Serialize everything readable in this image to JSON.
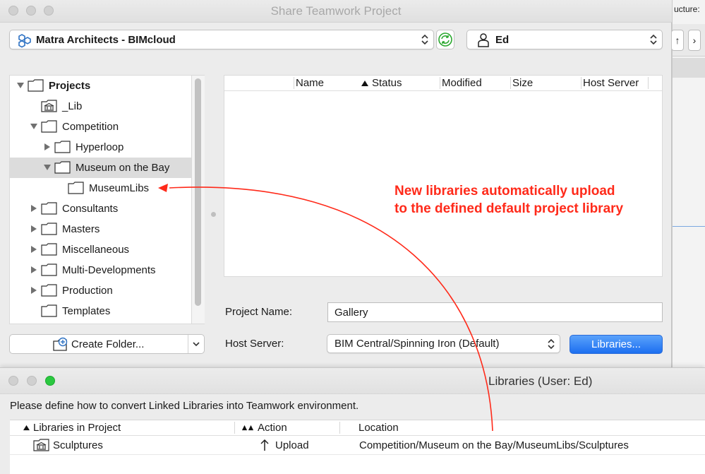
{
  "window": {
    "title": "Share Teamwork Project"
  },
  "background_app": {
    "label": "ucture:",
    "toolbar_glyph_1": "↑",
    "toolbar_glyph_2": "›"
  },
  "server": {
    "selected": "Matra Architects - BIMcloud"
  },
  "user": {
    "selected": "Ed"
  },
  "tree": {
    "items": [
      {
        "label": "Projects",
        "level": 0,
        "expanded": true,
        "icon": "folder-icon"
      },
      {
        "label": "_Lib",
        "level": 1,
        "expanded": null,
        "icon": "library-icon"
      },
      {
        "label": "Competition",
        "level": 1,
        "expanded": true,
        "icon": "folder-icon"
      },
      {
        "label": "Hyperloop",
        "level": 2,
        "expanded": false,
        "icon": "folder-icon"
      },
      {
        "label": "Museum on the Bay",
        "level": 2,
        "expanded": true,
        "icon": "folder-icon",
        "selected": true
      },
      {
        "label": "MuseumLibs",
        "level": 3,
        "expanded": null,
        "icon": "folder-icon"
      },
      {
        "label": "Consultants",
        "level": 1,
        "expanded": false,
        "icon": "folder-icon"
      },
      {
        "label": "Masters",
        "level": 1,
        "expanded": false,
        "icon": "folder-icon"
      },
      {
        "label": "Miscellaneous",
        "level": 1,
        "expanded": false,
        "icon": "folder-icon"
      },
      {
        "label": "Multi-Developments",
        "level": 1,
        "expanded": false,
        "icon": "folder-icon"
      },
      {
        "label": "Production",
        "level": 1,
        "expanded": false,
        "icon": "folder-icon"
      },
      {
        "label": "Templates",
        "level": 1,
        "expanded": null,
        "icon": "folder-icon"
      }
    ]
  },
  "create_folder": {
    "label": "Create Folder..."
  },
  "project_list": {
    "columns": [
      "Name",
      "Status",
      "Modified",
      "Size",
      "Host Server"
    ],
    "sorted_column": "Status"
  },
  "form": {
    "project_name_label": "Project Name:",
    "project_name_value": "Gallery",
    "host_server_label": "Host Server:",
    "host_server_value": "BIM Central/Spinning Iron (Default)",
    "libraries_button": "Libraries..."
  },
  "annotation": {
    "text": "New libraries automatically upload to the defined default project library",
    "color": "#ff2a1a"
  },
  "libraries_dialog": {
    "title": "Libraries (User: Ed)",
    "instruction": "Please define how to convert Linked Libraries into Teamwork environment.",
    "columns": [
      "Libraries in Project",
      "Action",
      "Location"
    ],
    "rows": [
      {
        "library": "Sculptures",
        "action": "Upload",
        "location": "Competition/Museum on the Bay/MuseumLibs/Sculptures"
      }
    ]
  },
  "colors": {
    "accent": "#1c6ff0",
    "annotation_red": "#ff2a1a",
    "traffic_green": "#2ac840"
  }
}
